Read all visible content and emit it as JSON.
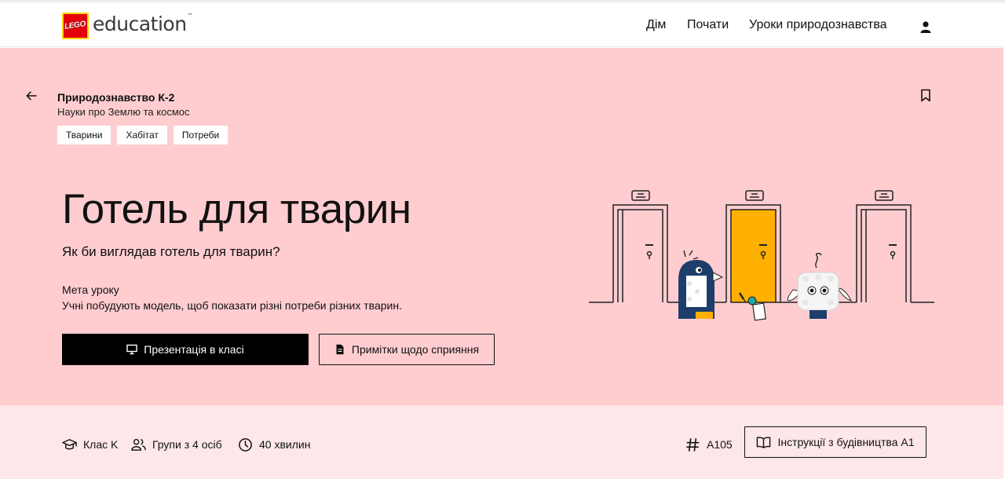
{
  "header": {
    "logo_brand": "LEGO",
    "logo_product": "education",
    "nav": [
      {
        "label": "Дім"
      },
      {
        "label": "Почати"
      },
      {
        "label": "Уроки природознавства"
      }
    ],
    "user_icon": "user-icon"
  },
  "hero": {
    "back_icon": "arrow-left-icon",
    "bookmark_icon": "bookmark-icon",
    "course_title": "Природознавство К-2",
    "course_subtitle": "Науки про Землю та космос",
    "tags": [
      "Тварини",
      "Хабітат",
      "Потреби"
    ],
    "lesson_title": "Готель для тварин",
    "lesson_question": "Як би виглядав готель для тварин?",
    "goal_label": "Мета уроку",
    "goal_text": "Учні побудують модель, щоб показати різні потреби різних тварин.",
    "primary_button": "Презентація в класі",
    "secondary_button": "Примітки щодо сприяння",
    "background_color": "#ffcdd0",
    "door_accent_color": "#ffb000"
  },
  "info_bar": {
    "grade": "Клас K",
    "groups": "Групи з 4 осіб",
    "duration": "40 хвилин",
    "code": "A105",
    "build_button": "Інструкції з будівництва A1",
    "background_color": "#fde7e8"
  }
}
